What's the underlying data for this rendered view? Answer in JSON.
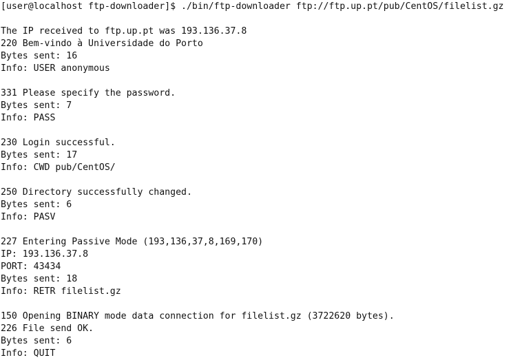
{
  "terminal": {
    "prompt": "[user@localhost ftp-downloader]$",
    "command": "./bin/ftp-downloader ftp://ftp.up.pt/pub/CentOS/filelist.gz",
    "lines": [
      "The IP received to ftp.up.pt was 193.136.37.8",
      "220 Bem-vindo à Universidade do Porto",
      "Bytes sent: 16",
      "Info: USER anonymous",
      "",
      "331 Please specify the password.",
      "Bytes sent: 7",
      "Info: PASS",
      "",
      "230 Login successful.",
      "Bytes sent: 17",
      "Info: CWD pub/CentOS/",
      "",
      "250 Directory successfully changed.",
      "Bytes sent: 6",
      "Info: PASV",
      "",
      "227 Entering Passive Mode (193,136,37,8,169,170)",
      "IP: 193.136.37.8",
      "PORT: 43434",
      "Bytes sent: 18",
      "Info: RETR filelist.gz",
      "",
      "150 Opening BINARY mode data connection for filelist.gz (3722620 bytes).",
      "226 File send OK.",
      "Bytes sent: 6",
      "Info: QUIT"
    ]
  }
}
